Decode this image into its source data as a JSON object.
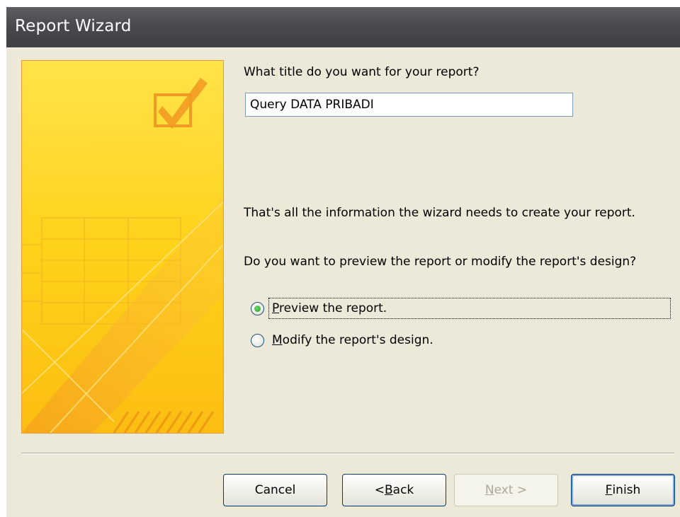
{
  "window": {
    "title": "Report Wizard"
  },
  "title_prompt": "What title do you want for your report?",
  "title_input": {
    "value": "Query DATA PRIBADI"
  },
  "info_text": "That's all the information the wizard needs to create your report.",
  "question_text": "Do you want to preview the report or modify the report's design?",
  "options": [
    {
      "label": "Preview the report.",
      "access_key": "P",
      "rest": "review the report.",
      "checked": true
    },
    {
      "label": "Modify the report's design.",
      "access_key": "M",
      "rest": "odify the report's design.",
      "checked": false
    }
  ],
  "buttons": {
    "cancel": {
      "label": "Cancel"
    },
    "back": {
      "prefix": "< ",
      "key": "B",
      "rest": "ack",
      "label": "< Back"
    },
    "next": {
      "key": "N",
      "rest": "ext >",
      "label": "Next >",
      "disabled": true
    },
    "finish": {
      "key": "F",
      "rest": "inish",
      "label": "Finish"
    }
  },
  "colors": {
    "accent": "#21a121",
    "banner": "#ffc515",
    "titlebar": "#4a4b4f"
  }
}
